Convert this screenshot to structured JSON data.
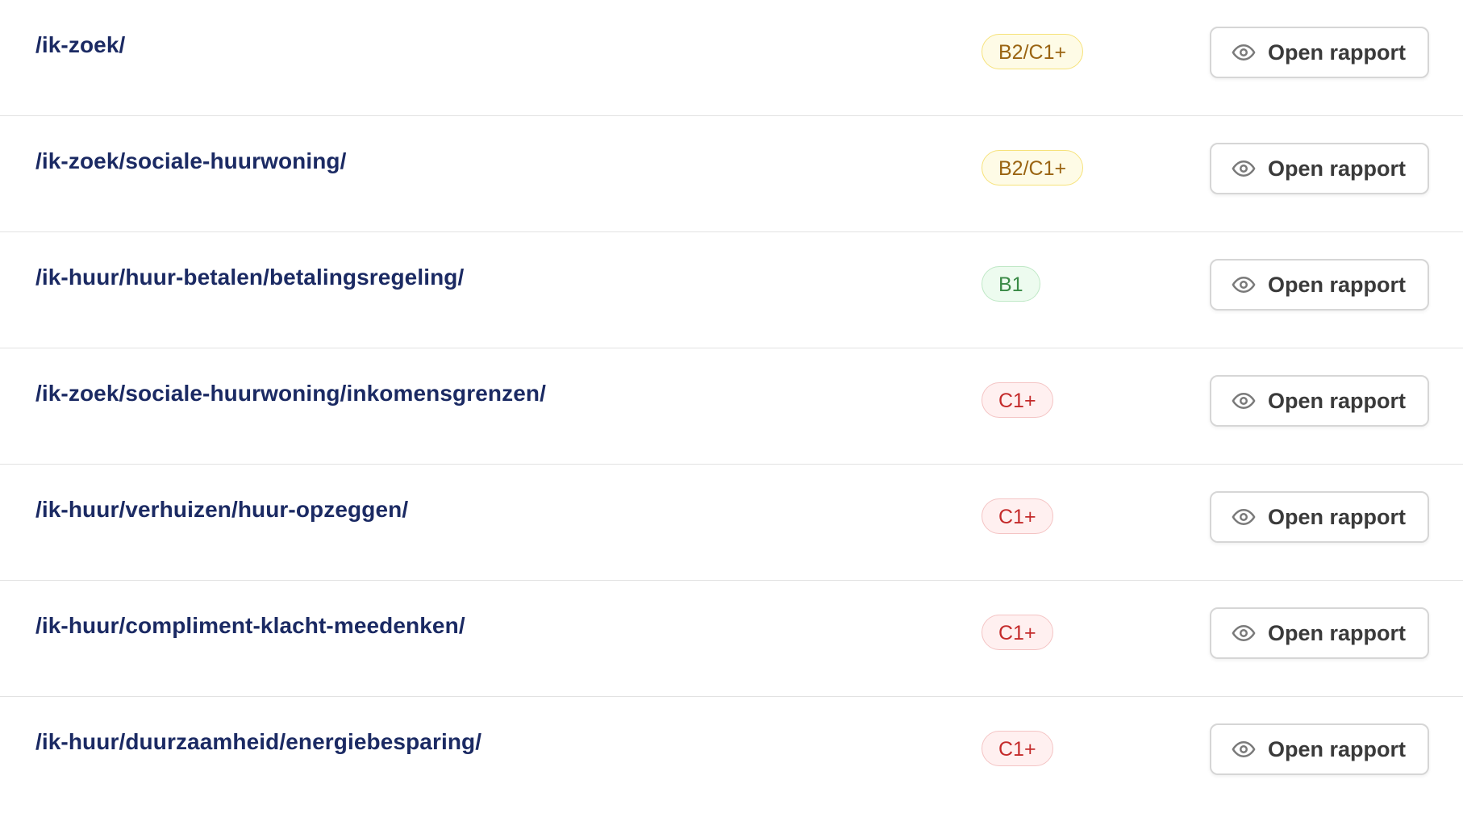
{
  "rows": [
    {
      "url": "/ik-zoek/",
      "level": "B2/C1+",
      "level_status": "warn",
      "action": "Open rapport"
    },
    {
      "url": "/ik-zoek/sociale-huurwoning/",
      "level": "B2/C1+",
      "level_status": "warn",
      "action": "Open rapport"
    },
    {
      "url": "/ik-huur/huur-betalen/betalingsregeling/",
      "level": "B1",
      "level_status": "ok",
      "action": "Open rapport"
    },
    {
      "url": "/ik-zoek/sociale-huurwoning/inkomensgrenzen/",
      "level": "C1+",
      "level_status": "bad",
      "action": "Open rapport"
    },
    {
      "url": "/ik-huur/verhuizen/huur-opzeggen/",
      "level": "C1+",
      "level_status": "bad",
      "action": "Open rapport"
    },
    {
      "url": "/ik-huur/compliment-klacht-meedenken/",
      "level": "C1+",
      "level_status": "bad",
      "action": "Open rapport"
    },
    {
      "url": "/ik-huur/duurzaamheid/energiebesparing/",
      "level": "C1+",
      "level_status": "bad",
      "action": "Open rapport"
    }
  ],
  "icons": {
    "action_icon": "eye-icon"
  },
  "colors": {
    "url_text": "#1b2a63",
    "badge_warn_text": "#9a6412",
    "badge_ok_text": "#3a8a46",
    "badge_bad_text": "#c42a2a"
  }
}
